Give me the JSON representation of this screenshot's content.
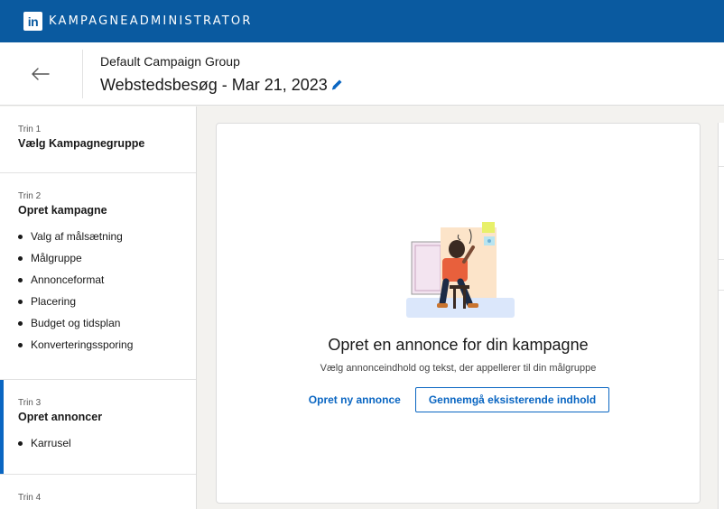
{
  "topbar": {
    "logo_text": "in",
    "title": "KAMPAGNEADMINISTRATOR"
  },
  "header": {
    "group_name": "Default Campaign Group",
    "campaign_name": "Webstedsbesøg - Mar 21, 2023",
    "back_icon": "arrow-left-icon",
    "edit_icon": "pencil-icon"
  },
  "sidebar": {
    "steps": [
      {
        "num": "Trin 1",
        "title": "Vælg Kampagnegruppe",
        "items": []
      },
      {
        "num": "Trin 2",
        "title": "Opret kampagne",
        "items": [
          "Valg af målsætning",
          "Målgruppe",
          "Annonceformat",
          "Placering",
          "Budget og tidsplan",
          "Konverteringssporing"
        ]
      },
      {
        "num": "Trin 3",
        "title": "Opret annoncer",
        "items": [
          "Karrusel"
        ]
      },
      {
        "num": "Trin 4",
        "title": "",
        "items": []
      }
    ]
  },
  "main": {
    "title": "Opret en annonce for din kampagne",
    "subtitle": "Vælg annonceindhold og tekst, der appellerer til din målgruppe",
    "create_button": "Opret ny annonce",
    "review_button": "Gennemgå eksisterende indhold"
  },
  "colors": {
    "brand": "#0a5aa0",
    "accent": "#0a66c2"
  }
}
